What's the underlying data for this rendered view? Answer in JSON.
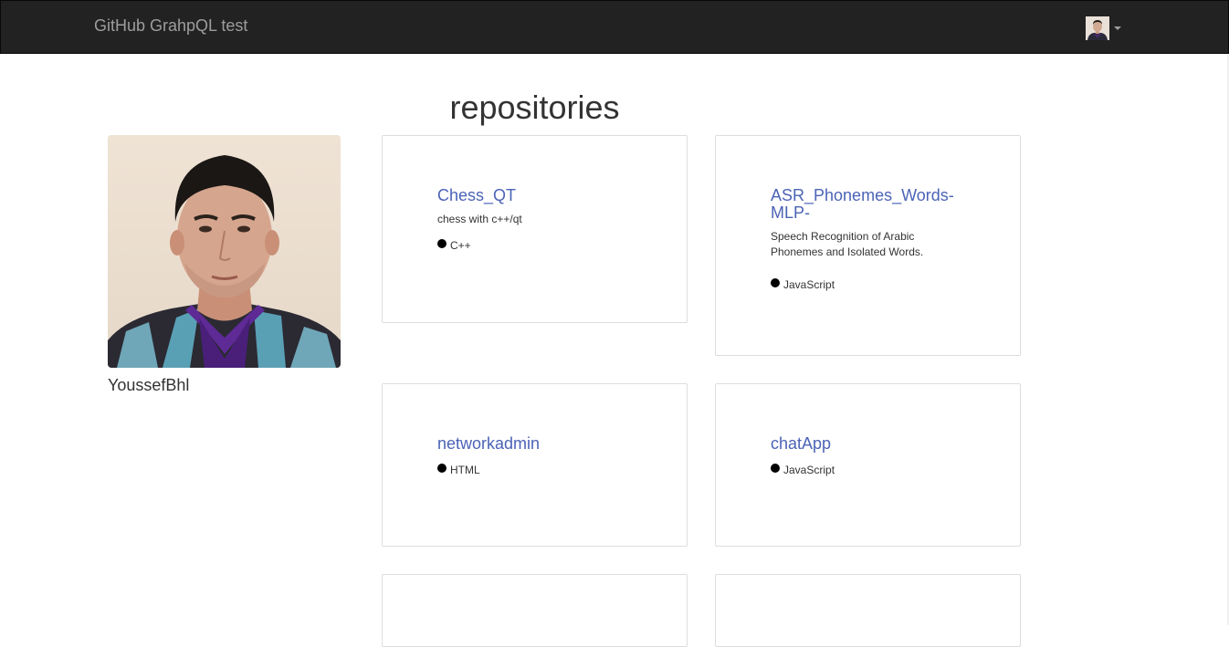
{
  "navbar": {
    "brand": "GitHub GrahpQL test"
  },
  "page": {
    "title": "repositories"
  },
  "profile": {
    "username": "YoussefBhl"
  },
  "repositories": [
    {
      "name": "Chess_QT",
      "description": "chess with c++/qt",
      "language": "C++"
    },
    {
      "name": "ASR_Phonemes_Words-MLP-",
      "description": "Speech Recognition of Arabic Phonemes and Isolated Words.",
      "language": "JavaScript"
    },
    {
      "name": "networkadmin",
      "description": "",
      "language": "HTML"
    },
    {
      "name": "chatApp",
      "description": "",
      "language": "JavaScript"
    }
  ],
  "colors": {
    "navbar_bg": "#222222",
    "brand_text": "#9d9d9d",
    "link": "#4b63b6",
    "card_border": "#dddddd",
    "language_dot": "#000000"
  }
}
